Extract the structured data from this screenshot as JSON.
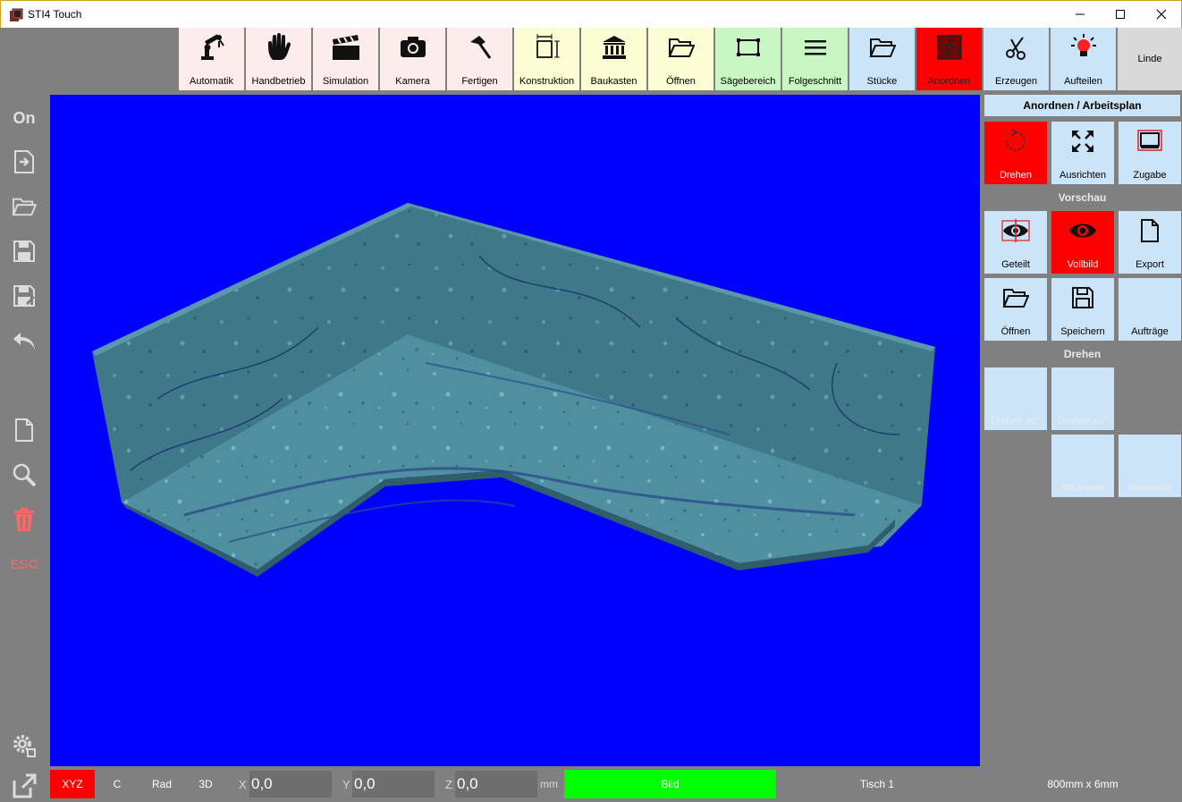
{
  "window": {
    "title": "STI4 Touch",
    "minimize": "—",
    "maximize": "☐",
    "close": "✕"
  },
  "toolbar": [
    {
      "label": "Automatik",
      "icon": "robot-arm-icon",
      "bg": "#fdecec"
    },
    {
      "label": "Handbetrieb",
      "icon": "hand-icon",
      "bg": "#fdecec"
    },
    {
      "label": "Simulation",
      "icon": "clapperboard-icon",
      "bg": "#fdecec"
    },
    {
      "label": "Kamera",
      "icon": "camera-icon",
      "bg": "#fdecec"
    },
    {
      "label": "Fertigen",
      "icon": "hammer-icon",
      "bg": "#fdecec"
    },
    {
      "label": "Konstruktion",
      "icon": "dimension-icon",
      "bg": "#fdfdd4"
    },
    {
      "label": "Baukasten",
      "icon": "bank-icon",
      "bg": "#fdfdd4"
    },
    {
      "label": "Öffnen",
      "icon": "folder-open-icon",
      "bg": "#fdfdd4"
    },
    {
      "label": "Sägebereich",
      "icon": "saw-area-icon",
      "bg": "#c9f7c3"
    },
    {
      "label": "Folgeschnitt",
      "icon": "list-lines-icon",
      "bg": "#c9f7c3"
    },
    {
      "label": "Stücke",
      "icon": "folder-icon",
      "bg": "#cce4f7"
    },
    {
      "label": "Anordnen",
      "icon": "arrange-icon",
      "bg": "#ff0000"
    },
    {
      "label": "Erzeugen",
      "icon": "scissors-icon",
      "bg": "#cce4f7"
    },
    {
      "label": "Aufteilen",
      "icon": "lightbulb-icon",
      "bg": "#cce4f7"
    },
    {
      "label": "Linde",
      "icon": "",
      "bg": "#d9d9d9"
    }
  ],
  "left": {
    "on_label": "On",
    "esc_label": "ESC"
  },
  "right": {
    "header": "Anordnen / Arbeitsplan",
    "section_vorschau": "Vorschau",
    "section_drehen": "Drehen",
    "row1": [
      "Drehen",
      "Ausrichten",
      "Zugabe"
    ],
    "row2": [
      "Geteilt",
      "Vollbild",
      "Export"
    ],
    "row3": [
      "Öffnen",
      "Speichern",
      "Aufträge"
    ],
    "row4": [
      "Drehen 90°",
      "Drehen 45°"
    ],
    "row5": [
      "Rückseite",
      "Rückseite"
    ]
  },
  "status": {
    "xyz": "XYZ",
    "c": "C",
    "rad": "Rad",
    "d3": "3D",
    "x_label": "X",
    "x_value": "0,0",
    "y_label": "Y",
    "y_value": "0,0",
    "z_label": "Z",
    "z_value": "0,0",
    "unit": "mm",
    "bild": "Bild",
    "table": "Tisch 1",
    "material": "800mm x 6mm"
  },
  "colors": {
    "accent_red": "#ff0000",
    "viewport_bg": "#0000ff",
    "status_green": "#00ff00",
    "panel_blue": "#cce4f7"
  }
}
